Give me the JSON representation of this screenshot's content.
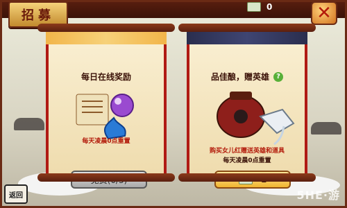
{
  "header": {
    "title": "招募",
    "currency_value": "0"
  },
  "left_panel": {
    "title": "每日在线奖励",
    "reset_note": "每天凌晨0点重置",
    "button_label": "免费(0/3)"
  },
  "right_panel": {
    "title": "品佳酿，赠英雄",
    "desc": "购买女儿红赠送英雄和道具",
    "reset_note": "每天凌晨0点重置",
    "button_value": "1"
  },
  "logo_text": "返回",
  "watermark": "5HE·游"
}
